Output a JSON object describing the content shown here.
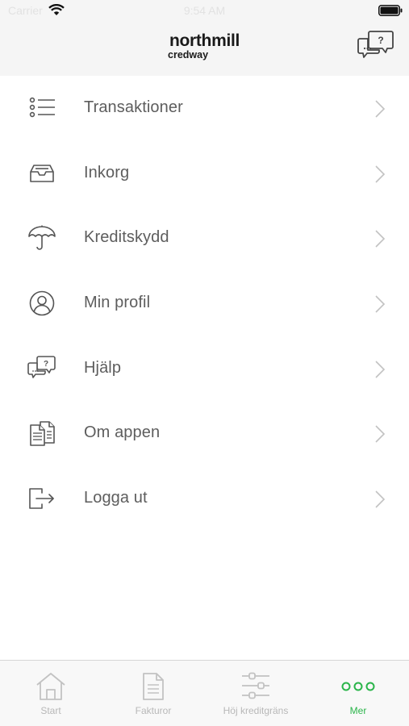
{
  "status_bar": {
    "carrier": "Carrier",
    "time": "9:54 AM"
  },
  "header": {
    "logo_line1": "northmill",
    "logo_line2": "credway"
  },
  "menu": {
    "items": [
      {
        "label": "Transaktioner",
        "icon": "list-icon"
      },
      {
        "label": "Inkorg",
        "icon": "inbox-icon"
      },
      {
        "label": "Kreditskydd",
        "icon": "umbrella-icon"
      },
      {
        "label": "Min profil",
        "icon": "profile-icon"
      },
      {
        "label": "Hjälp",
        "icon": "help-chat-icon"
      },
      {
        "label": "Om appen",
        "icon": "documents-icon"
      },
      {
        "label": "Logga ut",
        "icon": "logout-icon"
      }
    ]
  },
  "tabbar": {
    "tabs": [
      {
        "label": "Start",
        "icon": "home-icon"
      },
      {
        "label": "Fakturor",
        "icon": "invoice-icon"
      },
      {
        "label": "Höj kreditgräns",
        "icon": "sliders-icon"
      },
      {
        "label": "Mer",
        "icon": "more-dots-icon"
      }
    ],
    "active_tab": "Mer"
  },
  "colors": {
    "accent": "#2ab54a",
    "header_bg": "#f5f5f5",
    "text": "#5d5d5d",
    "icon": "#555555"
  }
}
